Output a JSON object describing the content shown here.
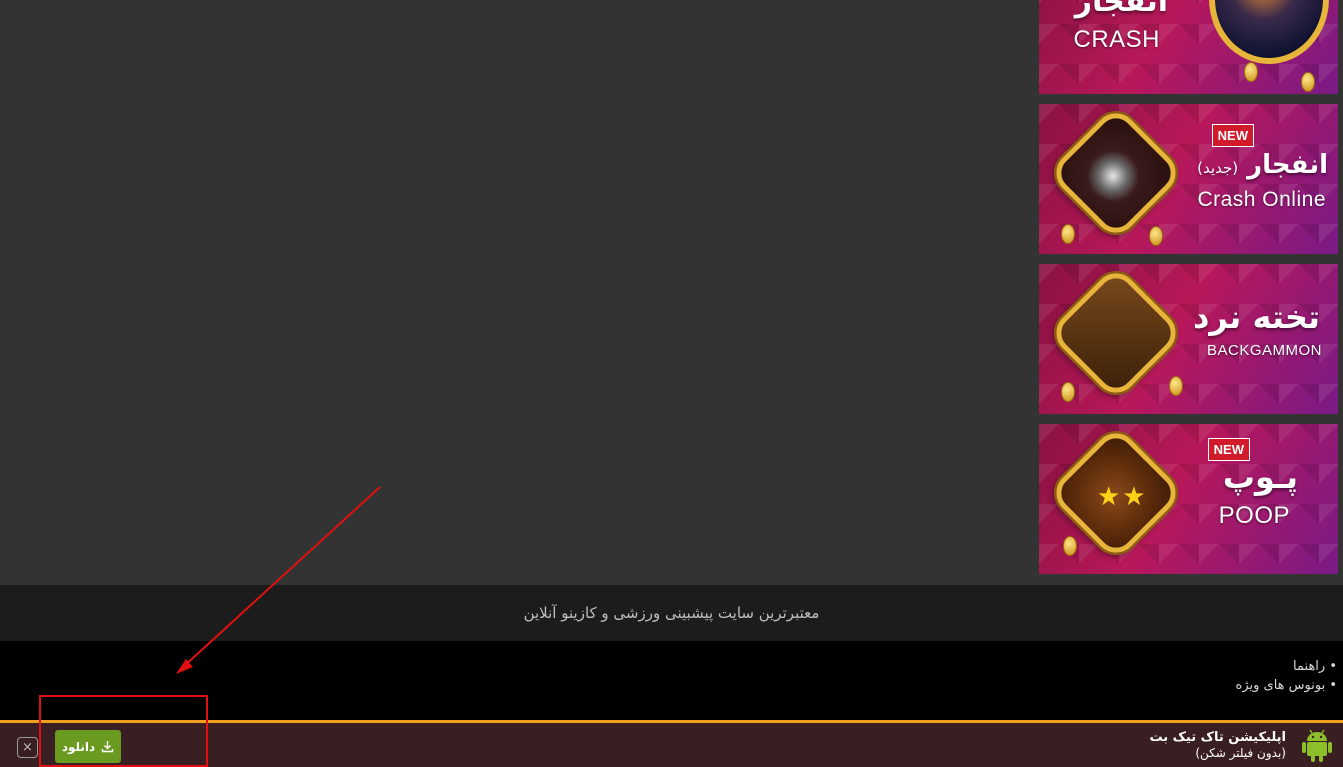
{
  "banners": [
    {
      "id": "crash",
      "title_fa": "انفجار",
      "title_en": "CRASH",
      "new": false
    },
    {
      "id": "crash-online",
      "title_fa": "انفجار",
      "subtitle_fa": "(جدید)",
      "title_en": "Crash Online",
      "new": true,
      "new_label": "NEW"
    },
    {
      "id": "backgammon",
      "title_fa": "تخته نرد",
      "title_en": "BACKGAMMON",
      "new": false
    },
    {
      "id": "poop",
      "title_fa": "پـوپ",
      "title_en": "POOP",
      "new": true,
      "new_label": "NEW"
    }
  ],
  "footer": {
    "tagline": "معتبرترین سایت پیشبینی ورزشی و کازینو آنلاین",
    "links": [
      "• راهنما",
      "• بونوس های ویژه"
    ]
  },
  "app_bar": {
    "title": "اپلیکیشن تاک تیک بت",
    "subtitle": "(بدون فیلتر شکن)",
    "download_label": "دانلود",
    "close_label": "×",
    "accent_color": "#f0a020",
    "button_color": "#6a9a1f",
    "icons": {
      "platform": "android-icon",
      "download": "download-icon",
      "close": "close-icon"
    }
  },
  "annotation": {
    "color": "#e01010"
  }
}
